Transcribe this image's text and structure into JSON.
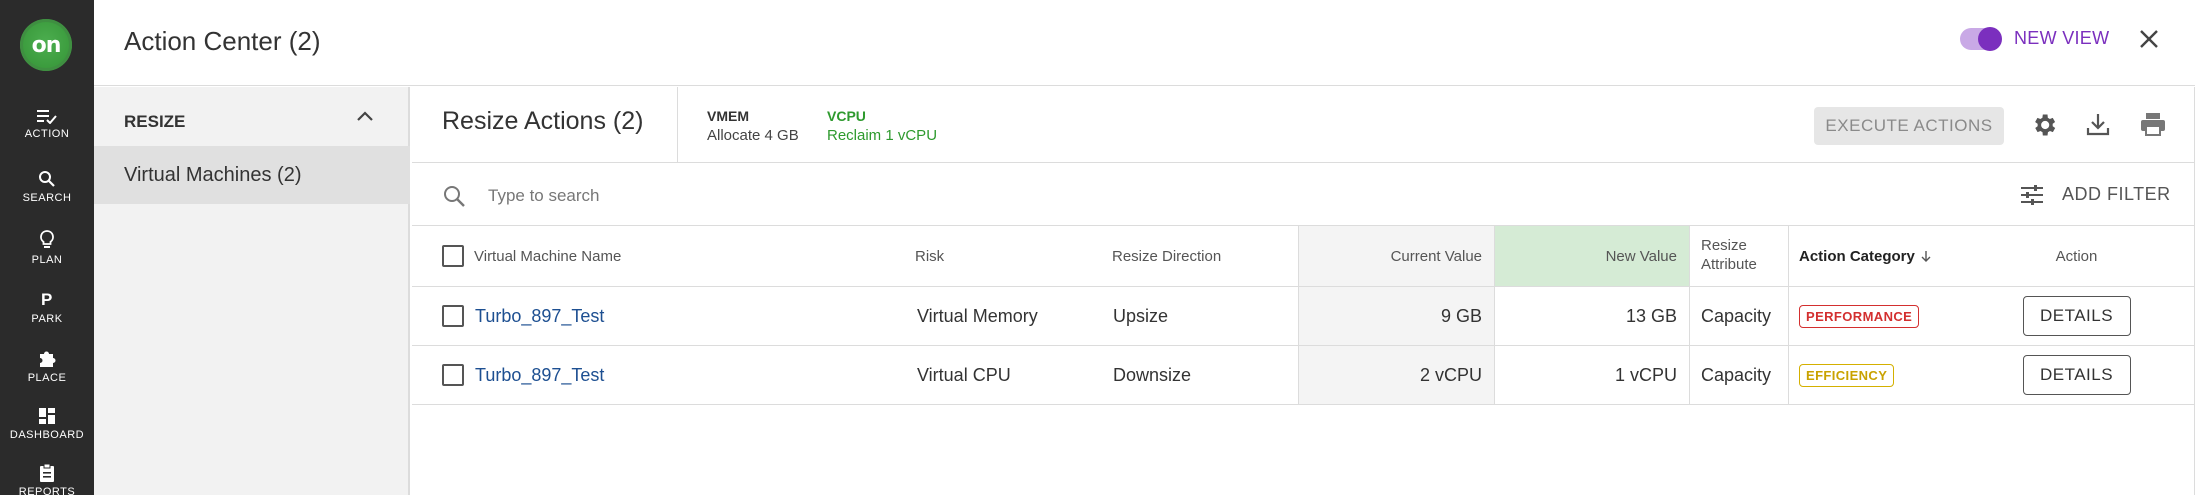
{
  "logo": {
    "text": "on"
  },
  "rail": [
    {
      "label": "ACTION",
      "icon": "action-icon"
    },
    {
      "label": "SEARCH",
      "icon": "search-icon"
    },
    {
      "label": "PLAN",
      "icon": "lightbulb-icon"
    },
    {
      "label": "PARK",
      "icon": "park-icon"
    },
    {
      "label": "PLACE",
      "icon": "puzzle-icon"
    },
    {
      "label": "DASHBOARD",
      "icon": "dashboard-icon"
    },
    {
      "label": "REPORTS",
      "icon": "reports-icon"
    }
  ],
  "header": {
    "title": "Action Center (2)",
    "new_view_label": "NEW VIEW",
    "toggle_on": true
  },
  "sidebar": {
    "section_title": "RESIZE",
    "items": [
      {
        "label": "Virtual Machines (2)",
        "selected": true
      }
    ]
  },
  "subheader": {
    "title": "Resize Actions (2)",
    "summary": [
      {
        "label": "VMEM",
        "value": "Allocate 4 GB"
      },
      {
        "label": "VCPU",
        "value": "Reclaim 1 vCPU"
      }
    ],
    "execute_label": "EXECUTE ACTIONS"
  },
  "search": {
    "placeholder": "Type to search",
    "value": "",
    "add_filter_label": "ADD FILTER"
  },
  "table": {
    "headers": {
      "name": "Virtual Machine Name",
      "risk": "Risk",
      "direction": "Resize Direction",
      "current": "Current Value",
      "new": "New Value",
      "attr": "Resize Attribute",
      "category": "Action Category",
      "action": "Action"
    },
    "rows": [
      {
        "name": "Turbo_897_Test",
        "risk": "Virtual Memory",
        "direction": "Upsize",
        "current": "9 GB",
        "new": "13 GB",
        "attr": "Capacity",
        "category": "PERFORMANCE",
        "action": "DETAILS"
      },
      {
        "name": "Turbo_897_Test",
        "risk": "Virtual CPU",
        "direction": "Downsize",
        "current": "2 vCPU",
        "new": "1 vCPU",
        "attr": "Capacity",
        "category": "EFFICIENCY",
        "action": "DETAILS"
      }
    ]
  },
  "colors": {
    "accent_purple": "#7b2fbe",
    "performance_red": "#d32f2f",
    "efficiency_yellow": "#c9a200",
    "link_blue": "#1d4f91",
    "vcpu_green": "#2e9a2e",
    "new_value_header_bg": "#d5ebd5"
  }
}
